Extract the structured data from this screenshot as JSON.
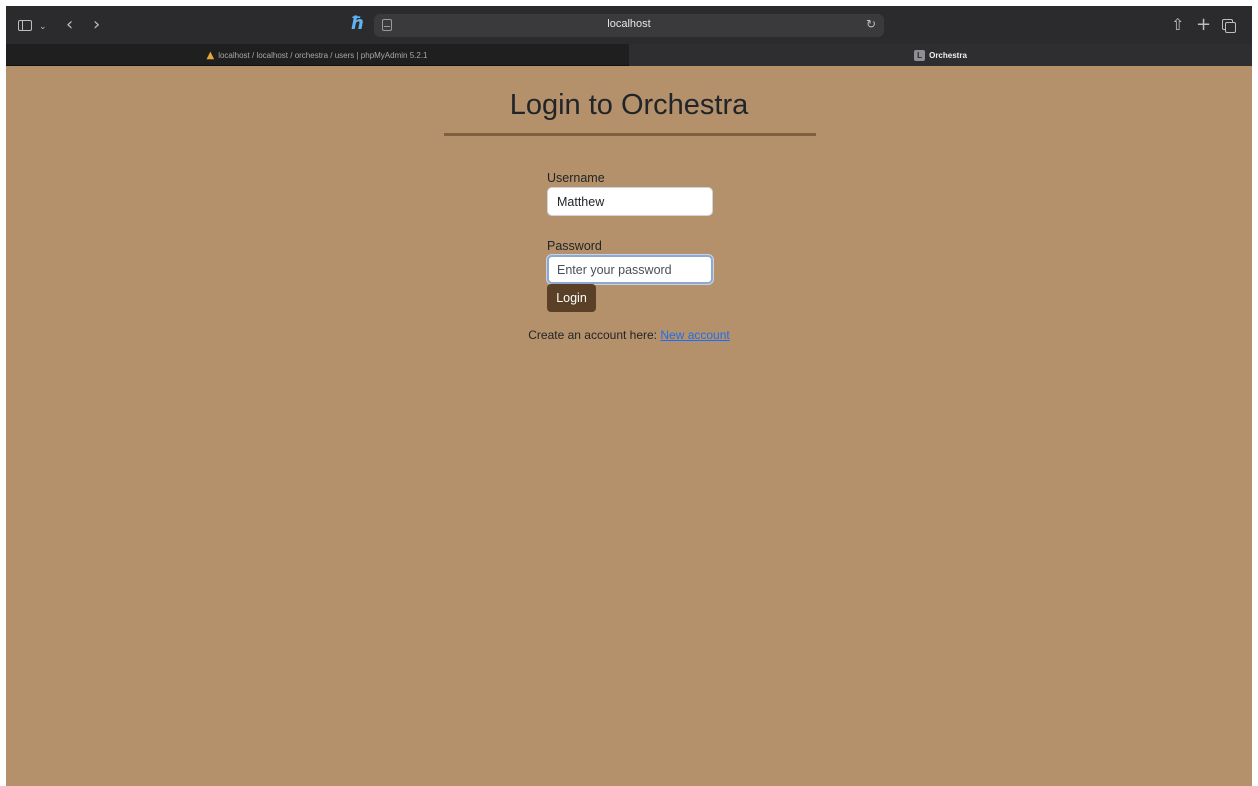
{
  "browser": {
    "url": "localhost",
    "tabs": [
      {
        "label": "localhost / localhost / orchestra / users | phpMyAdmin 5.2.1",
        "close": "×"
      },
      {
        "label": "Orchestra",
        "icon_letter": "L"
      }
    ]
  },
  "page": {
    "title": "Login to Orchestra",
    "username_label": "Username",
    "username_value": "Matthew",
    "password_label": "Password",
    "password_placeholder": "Enter your password",
    "login_label": "Login",
    "create_text": "Create an account here: ",
    "new_account_link": "New account"
  },
  "colors": {
    "page_background": "#b4916a",
    "title_rule": "#7f6142",
    "login_button": "#5a4026",
    "link": "#1a6ef5"
  }
}
